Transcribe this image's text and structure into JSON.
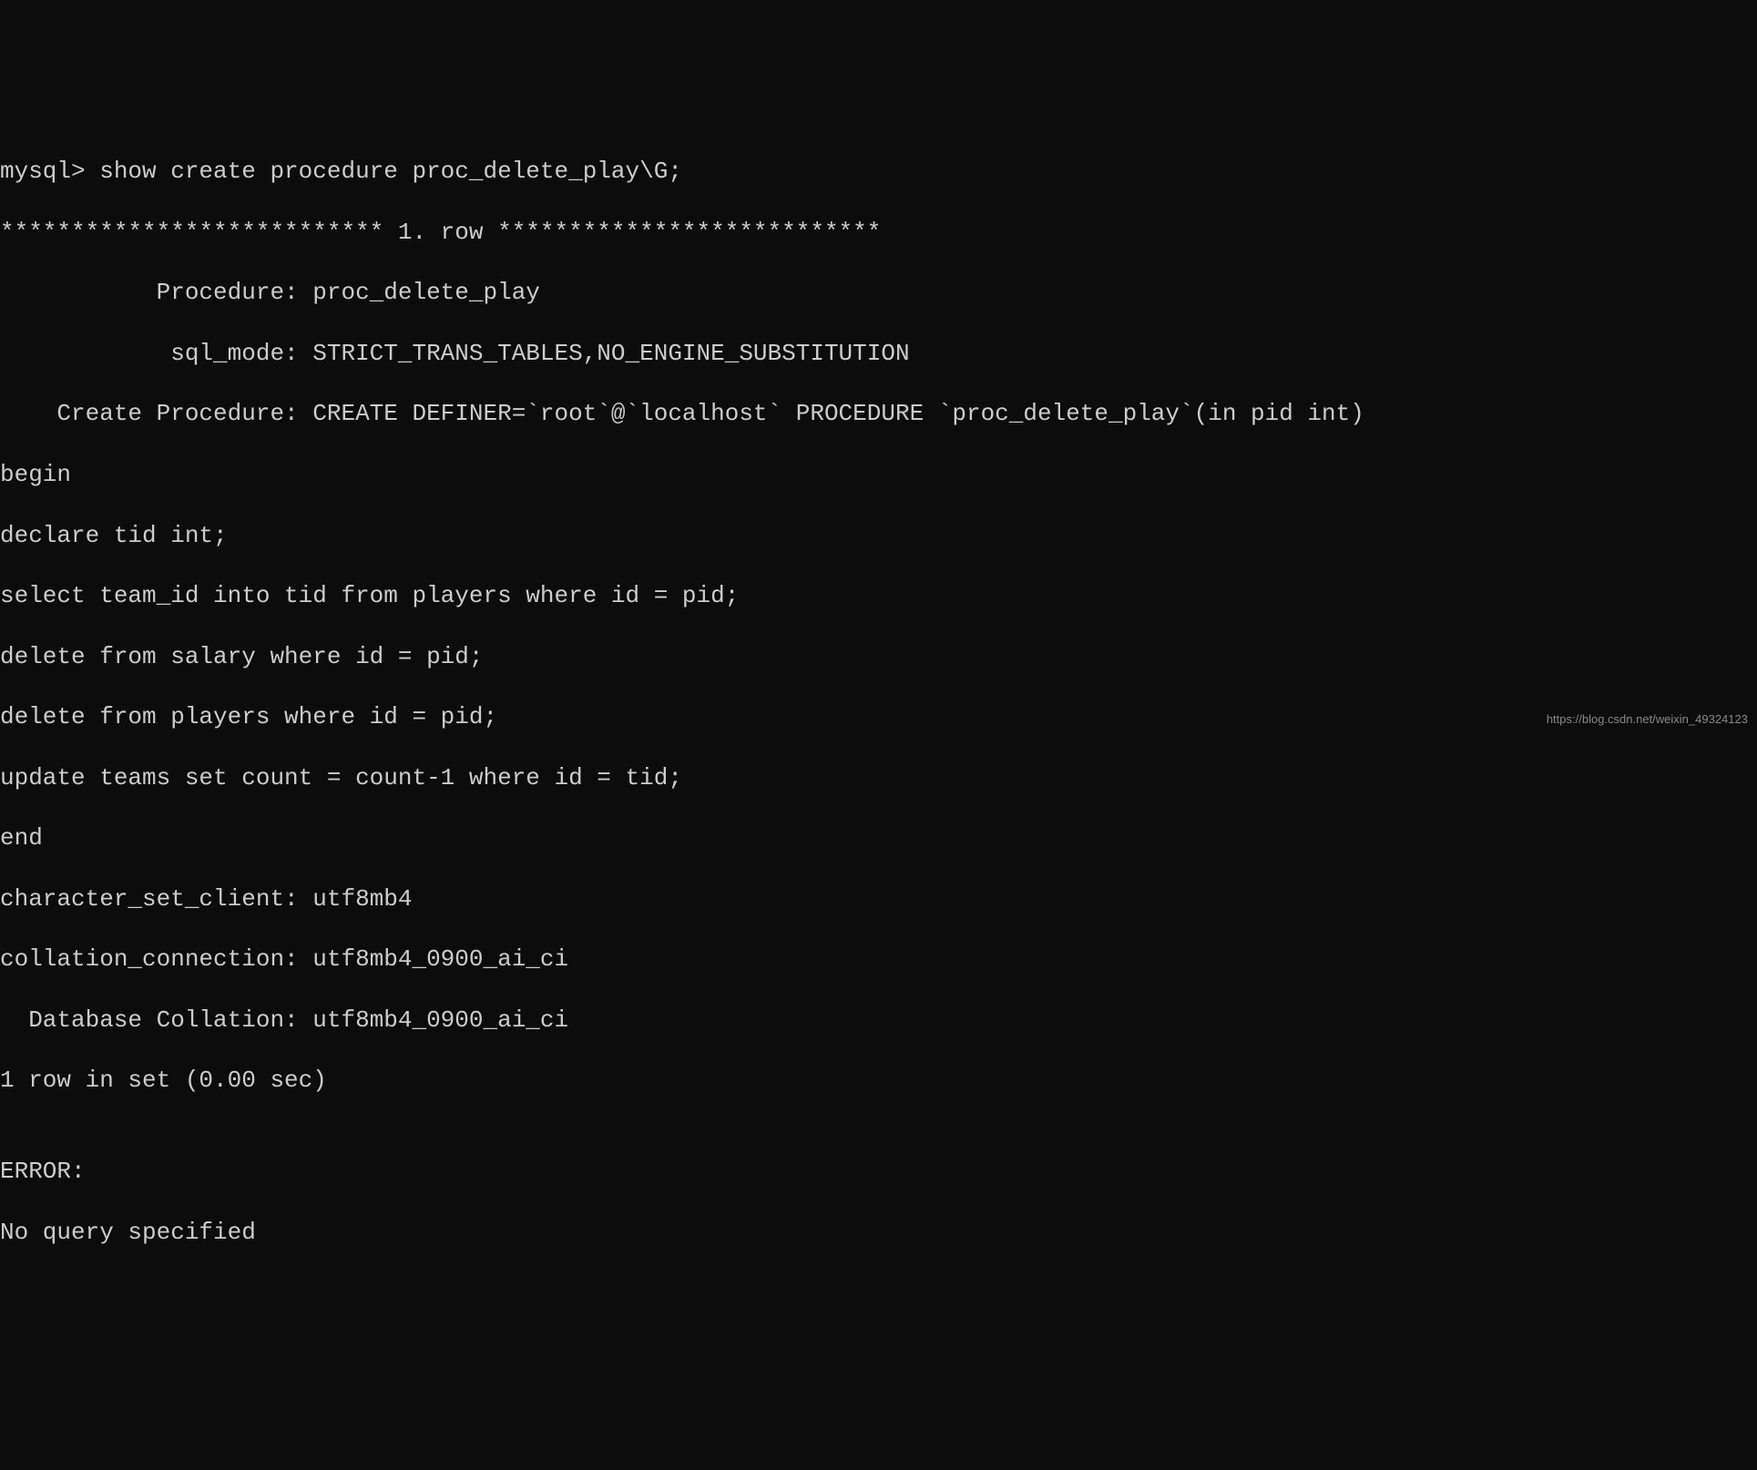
{
  "terminal": {
    "prompt_line": "mysql> show create procedure proc_delete_play\\G;",
    "row_separator": "*************************** 1. row ***************************",
    "procedure_label": "           Procedure: proc_delete_play",
    "sql_mode_label": "            sql_mode: STRICT_TRANS_TABLES,NO_ENGINE_SUBSTITUTION",
    "create_procedure_label": "    Create Procedure: CREATE DEFINER=`root`@`localhost` PROCEDURE `proc_delete_play`(in pid int)",
    "body_begin": "begin",
    "body_declare": "declare tid int;",
    "body_select": "select team_id into tid from players where id = pid;",
    "body_delete_salary": "delete from salary where id = pid;",
    "body_delete_players": "delete from players where id = pid;",
    "body_update": "update teams set count = count-1 where id = tid;",
    "body_end": "end",
    "charset_client": "character_set_client: utf8mb4",
    "collation_connection": "collation_connection: utf8mb4_0900_ai_ci",
    "database_collation": "  Database Collation: utf8mb4_0900_ai_ci",
    "row_count": "1 row in set (0.00 sec)",
    "blank": "",
    "error_label": "ERROR:",
    "error_message": "No query specified"
  },
  "watermark": "https://blog.csdn.net/weixin_49324123"
}
